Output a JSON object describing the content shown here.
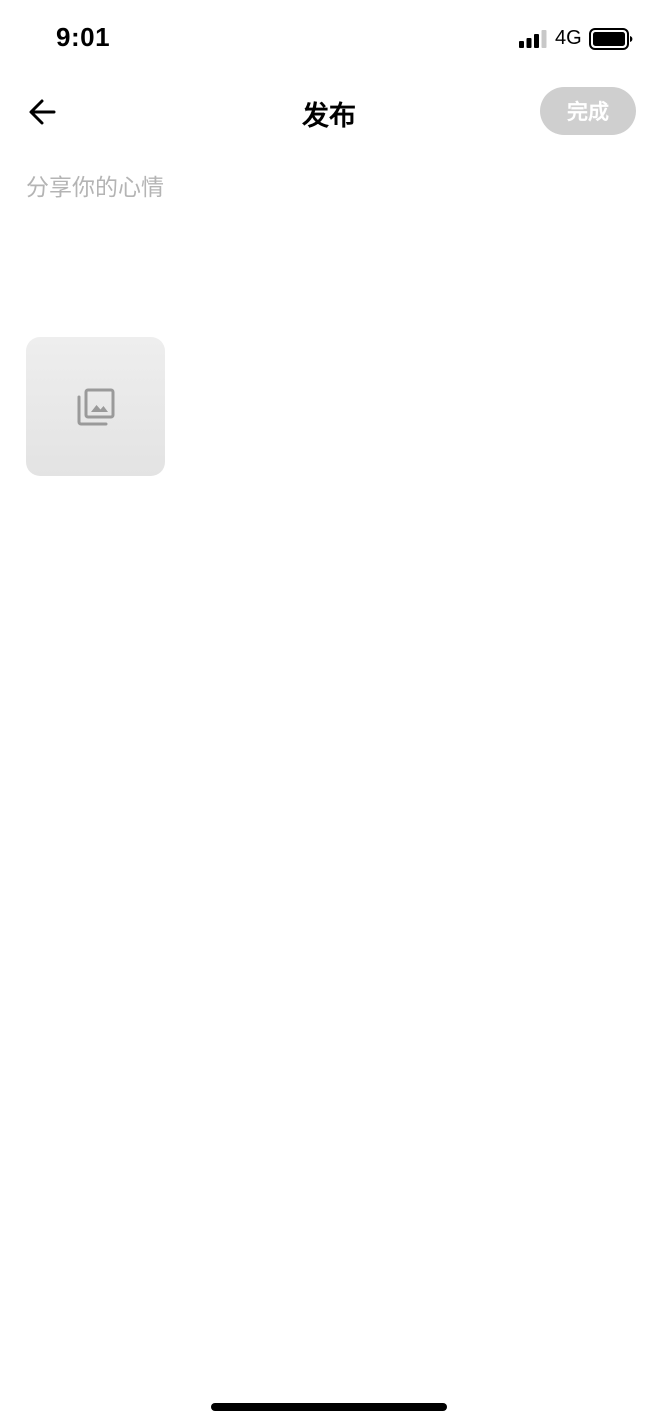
{
  "status_bar": {
    "time": "9:01",
    "network": "4G",
    "icons": [
      "signal-icon",
      "battery-icon"
    ]
  },
  "nav": {
    "back_icon": "arrow-left-icon",
    "title": "发布",
    "done_label": "完成"
  },
  "composer": {
    "placeholder": "分享你的心情",
    "value": "",
    "add_image_icon": "photo-library-icon"
  },
  "colors": {
    "done_button_bg": "#cfcfcf",
    "placeholder": "#b4b4b4",
    "tile_bg": "#e9e9e9",
    "tile_icon": "#9a9a9a"
  }
}
